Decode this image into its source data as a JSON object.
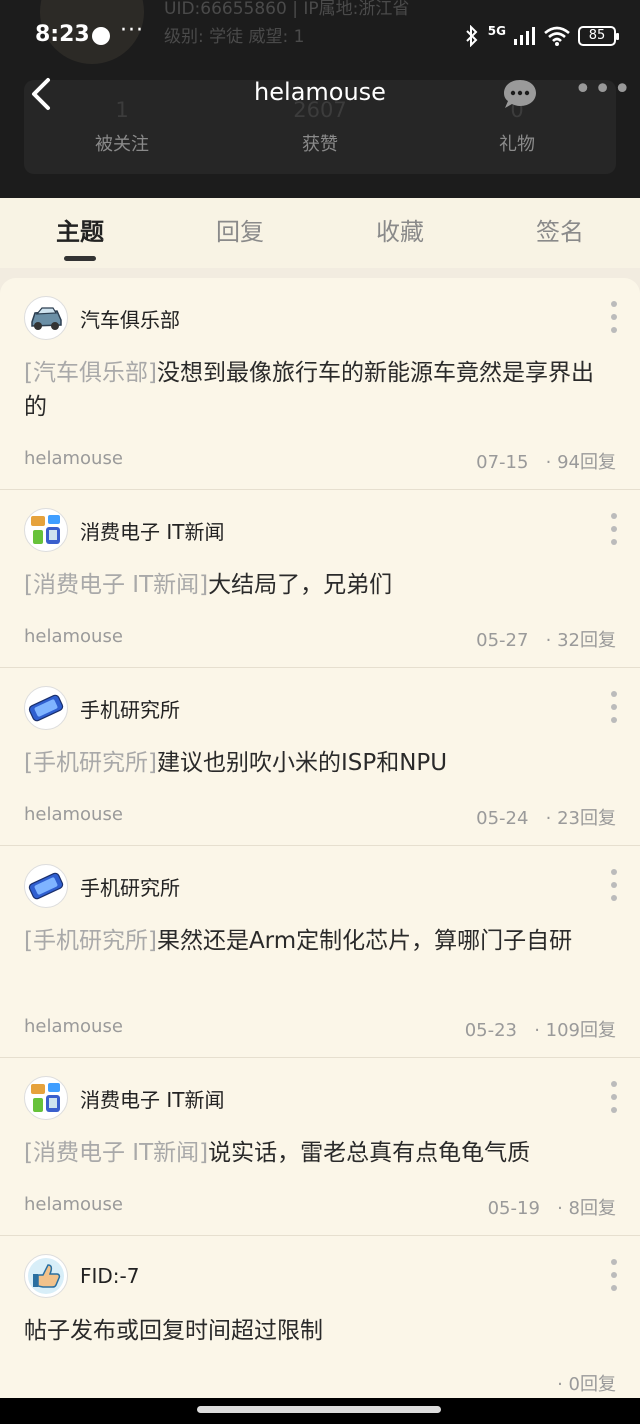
{
  "status_bar": {
    "time": "8:23",
    "more": "···",
    "network": "5G",
    "battery": "85"
  },
  "profile_bg": {
    "uid_line": "UID:66655860 | IP属地:浙江省",
    "level_line": "级别: 学徒   威望: 1",
    "stats": [
      {
        "value": "1",
        "label": "被关注"
      },
      {
        "value": "2607",
        "label": "获赞"
      },
      {
        "value": "0",
        "label": "礼物"
      }
    ]
  },
  "navbar": {
    "title": "helamouse",
    "more": "•••"
  },
  "tabs": [
    {
      "label": "主题",
      "active": true
    },
    {
      "label": "回复",
      "active": false
    },
    {
      "label": "收藏",
      "active": false
    },
    {
      "label": "签名",
      "active": false
    }
  ],
  "posts": [
    {
      "forum": "汽车俱乐部",
      "icon": "car-icon",
      "tag": "[汽车俱乐部]",
      "title": "没想到最像旅行车的新能源车竟然是享界出的",
      "author": "helamouse",
      "date": "07-15",
      "replies": "· 94回复"
    },
    {
      "forum": "消费电子 IT新闻",
      "icon": "electronics-icon",
      "tag": "[消费电子 IT新闻]",
      "title": "大结局了，兄弟们",
      "author": "helamouse",
      "date": "05-27",
      "replies": "· 32回复"
    },
    {
      "forum": "手机研究所",
      "icon": "phone-icon",
      "tag": "[手机研究所]",
      "title": "建议也别吹小米的ISP和NPU",
      "author": "helamouse",
      "date": "05-24",
      "replies": "· 23回复"
    },
    {
      "forum": "手机研究所",
      "icon": "phone-icon",
      "tag": "[手机研究所]",
      "title": "果然还是Arm定制化芯片，算哪门子自研",
      "author": "helamouse",
      "date": "05-23",
      "replies": "· 109回复"
    },
    {
      "forum": "消费电子 IT新闻",
      "icon": "electronics-icon",
      "tag": "[消费电子 IT新闻]",
      "title": "说实话，雷老总真有点龟龟气质",
      "author": "helamouse",
      "date": "05-19",
      "replies": "· 8回复"
    },
    {
      "forum": "FID:-7",
      "icon": "thumbs-up-icon",
      "tag": "",
      "title": "帖子发布或回复时间超过限制",
      "author": "",
      "date": "",
      "replies": "· 0回复"
    }
  ],
  "colors": {
    "accent_bg": "#fbf6e8",
    "header_bg": "#1c1c1c",
    "tag_gray": "#a9a9a9"
  }
}
